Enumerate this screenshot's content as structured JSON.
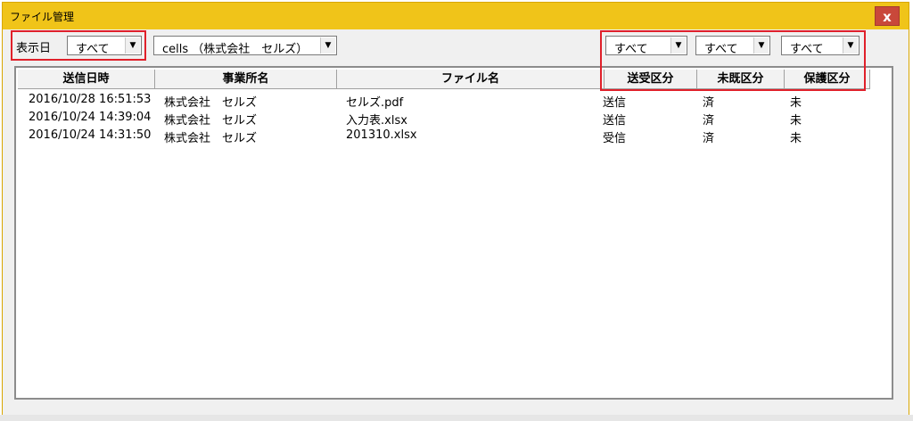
{
  "window": {
    "title": "ファイル管理",
    "close_label": "x"
  },
  "filters": {
    "date_label": "表示日",
    "date_value": "すべて",
    "office_value": "cells （株式会社　セルズ）",
    "send_recv_value": "すべて",
    "read_value": "すべて",
    "protect_value": "すべて"
  },
  "table": {
    "columns": [
      "送信日時",
      "事業所名",
      "ファイル名",
      "送受区分",
      "未既区分",
      "保護区分"
    ],
    "rows": [
      [
        "2016/10/28 16:51:53",
        "株式会社　セルズ",
        "セルズ.pdf",
        "送信",
        "済",
        "未"
      ],
      [
        "2016/10/24 14:39:04",
        "株式会社　セルズ",
        "入力表.xlsx",
        "送信",
        "済",
        "未"
      ],
      [
        "2016/10/24 14:31:50",
        "株式会社　セルズ",
        "201310.xlsx",
        "受信",
        "済",
        "未"
      ]
    ]
  },
  "colors": {
    "titlebar": "#f0c419",
    "close": "#c9483a",
    "highlight": "#e0202a"
  }
}
